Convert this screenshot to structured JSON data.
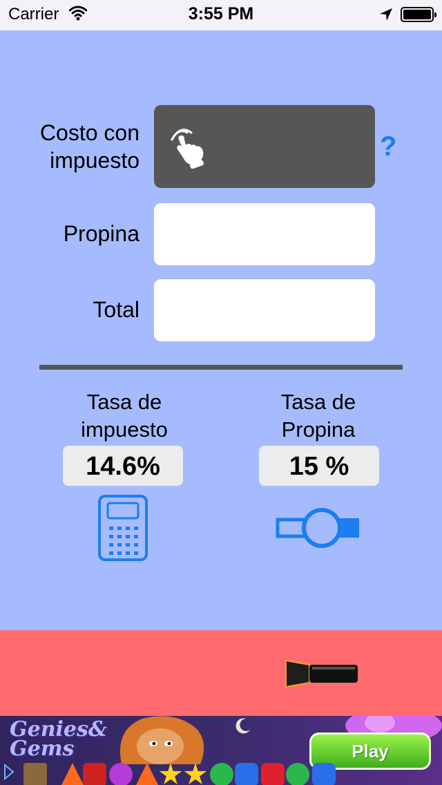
{
  "status_bar": {
    "carrier": "Carrier",
    "time": "3:55 PM"
  },
  "form": {
    "cost_label_line1": "Costo con",
    "cost_label_line2": "impuesto",
    "help": "?",
    "tip_label": "Propina",
    "total_label": "Total"
  },
  "rates": {
    "tax_label_line1": "Tasa de",
    "tax_label_line2": "impuesto",
    "tax_value": "14.6%",
    "tip_label_line1": "Tasa de",
    "tip_label_line2": "Propina",
    "tip_value": "15 %"
  },
  "icons": {
    "cost_field": "touch-hand-icon",
    "tax": "calculator-icon",
    "tip": "slider-toggle-icon",
    "flashlight": "flashlight-icon"
  },
  "ad": {
    "title_line1": "Genies&",
    "title_line2": "Gems",
    "play_label": "Play"
  },
  "colors": {
    "background": "#a6bbfd",
    "accent": "#1c7ef0",
    "red_bar": "#ff6b6f",
    "cost_field": "#565656"
  }
}
